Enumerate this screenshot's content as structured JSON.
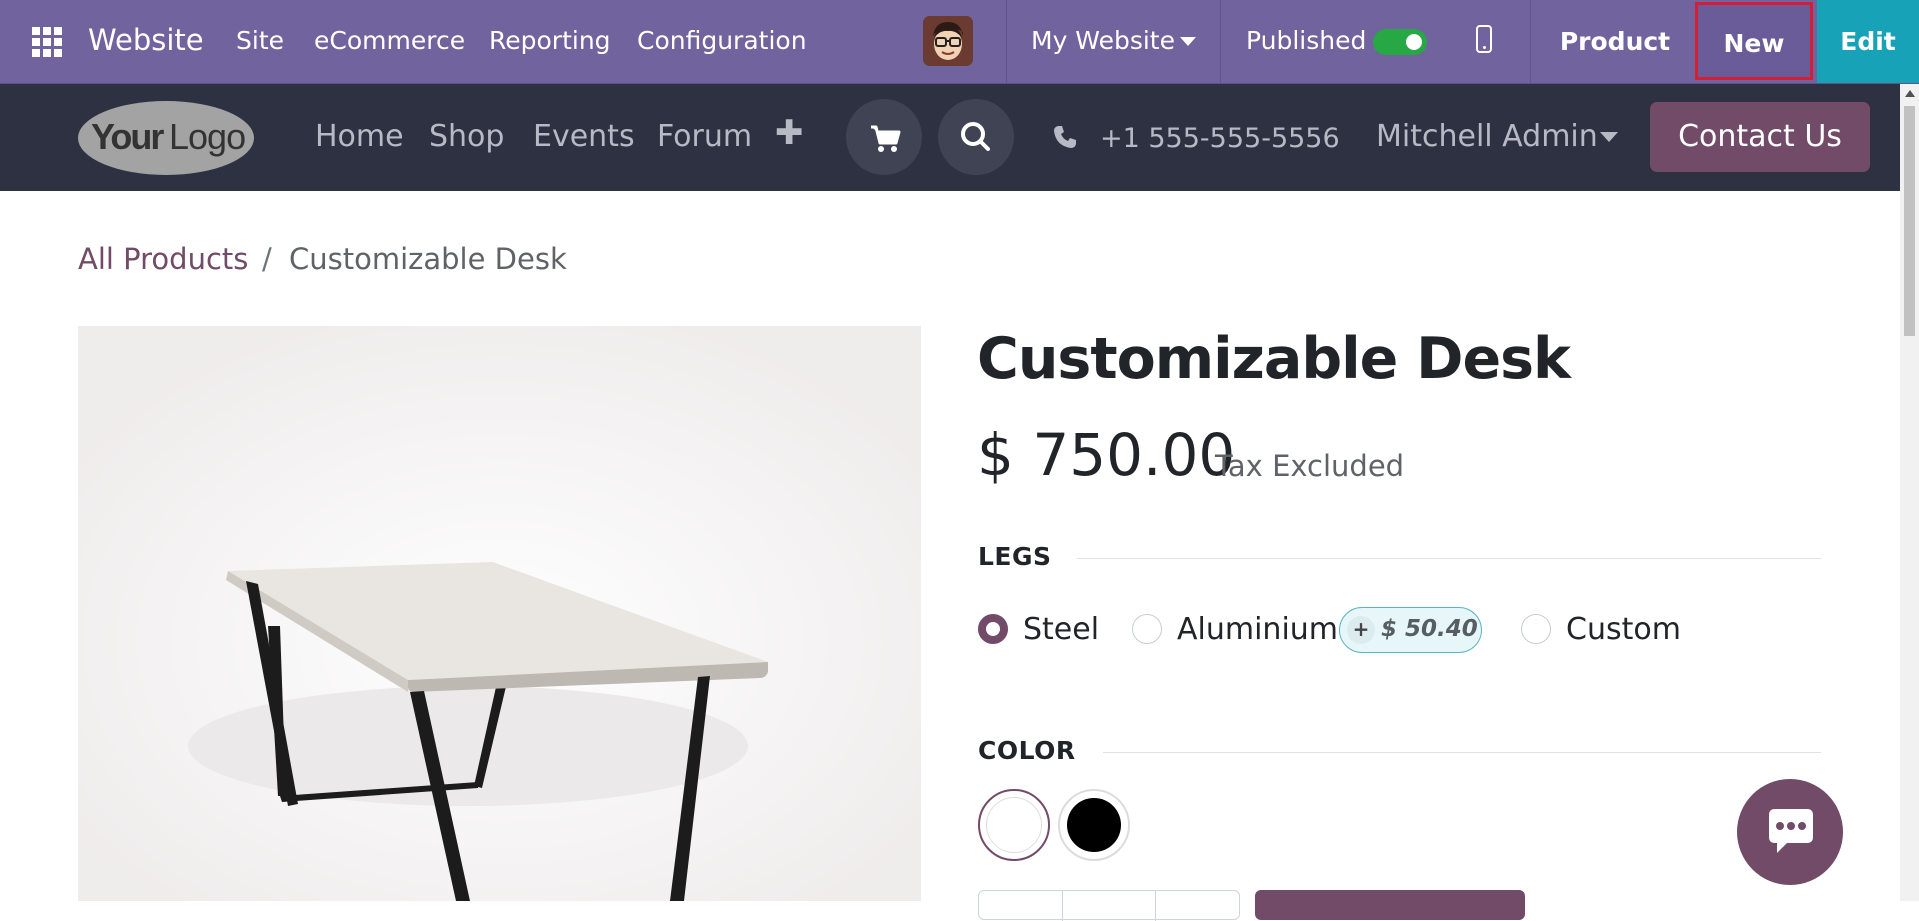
{
  "topbar": {
    "brand": "Website",
    "menu": [
      "Site",
      "eCommerce",
      "Reporting",
      "Configuration"
    ],
    "website_selector": "My Website",
    "published_label": "Published",
    "published": true,
    "product_label": "Product",
    "new_label": "New",
    "edit_label": "Edit"
  },
  "navbar": {
    "logo_text": "YourLogo",
    "links": [
      "Home",
      "Shop",
      "Events",
      "Forum"
    ],
    "plus": "✚",
    "phone": "+1 555-555-5556",
    "user": "Mitchell Admin",
    "contact_label": "Contact Us"
  },
  "breadcrumb": {
    "parent": "All Products",
    "separator": "/",
    "current": "Customizable Desk"
  },
  "product": {
    "title": "Customizable Desk",
    "price": "$ 750.00",
    "tax_note": "Tax Excluded",
    "legs": {
      "label": "LEGS",
      "options": [
        {
          "label": "Steel",
          "selected": true
        },
        {
          "label": "Aluminium",
          "selected": false,
          "extra_sign": "+",
          "extra": "$ 50.40"
        },
        {
          "label": "Custom",
          "selected": false
        }
      ]
    },
    "color": {
      "label": "COLOR",
      "swatches": [
        {
          "color": "#ffffff",
          "selected": true
        },
        {
          "color": "#000000",
          "selected": false
        }
      ]
    }
  },
  "colors": {
    "odoo_bar": "#71639e",
    "navbar": "#2d3142",
    "brand": "#714b67",
    "edit": "#17a2b8",
    "published_toggle": "#28a745",
    "highlight_border": "#d41e35"
  },
  "icons": {
    "apps": "grid-icon",
    "cart": "cart-icon",
    "search": "search-icon",
    "phone": "phone-icon",
    "mobile": "mobile-preview-icon",
    "chat": "chat-icon"
  }
}
